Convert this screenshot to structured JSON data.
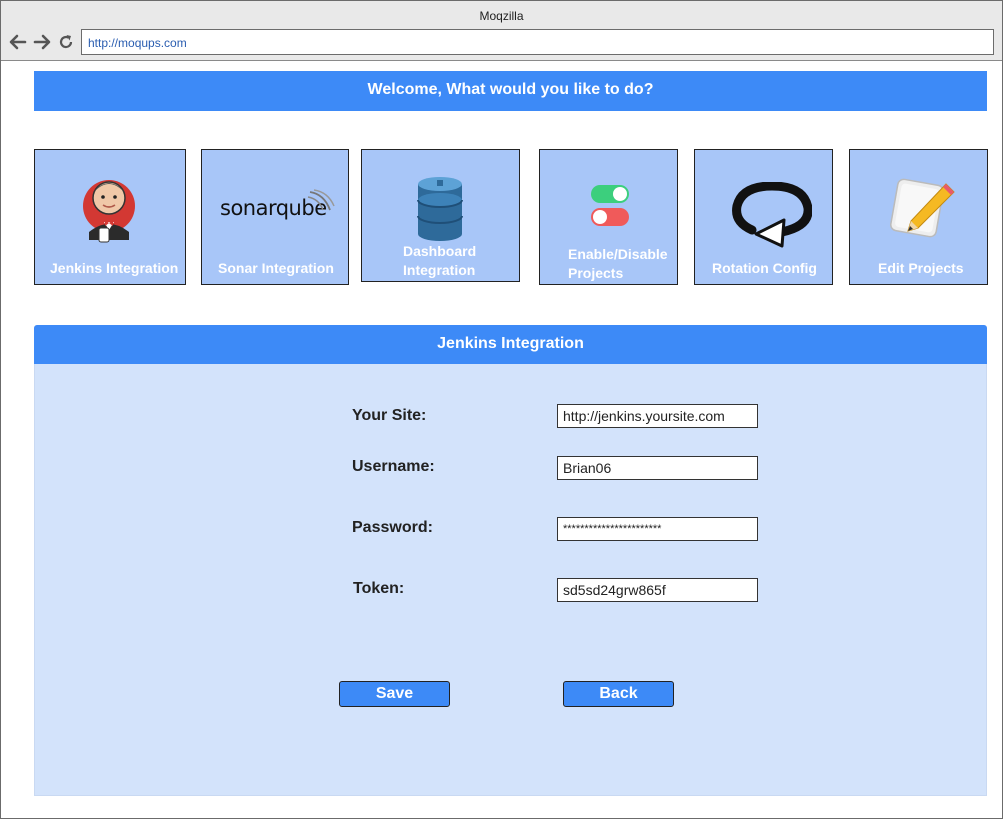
{
  "browser": {
    "title": "Moqzilla",
    "url": "http://moqups.com"
  },
  "welcome": "Welcome, What would you like to do?",
  "tiles": [
    {
      "label": "Jenkins Integration",
      "icon": "jenkins-butler-icon"
    },
    {
      "label": "Sonar Integration",
      "icon": "sonarqube-logo",
      "logo_text": "sonarqube"
    },
    {
      "label_lines": [
        "Dashboard",
        "Integration"
      ],
      "icon": "database-icon"
    },
    {
      "label_lines": [
        "Enable/Disable",
        "Projects"
      ],
      "icon": "toggle-switches-icon"
    },
    {
      "label": "Rotation Config",
      "icon": "rotation-arrow-icon"
    },
    {
      "label": "Edit Projects",
      "icon": "pencil-notepad-icon"
    }
  ],
  "panel": {
    "title": "Jenkins Integration",
    "fields": [
      {
        "label": "Your Site:",
        "value": "http://jenkins.yoursite.com"
      },
      {
        "label": "Username:",
        "value": "Brian06"
      },
      {
        "label": "Password:",
        "value": "***********************"
      },
      {
        "label": "Token:",
        "value": "sd5sd24grw865f"
      }
    ],
    "save_label": "Save",
    "back_label": "Back"
  },
  "colors": {
    "accent": "#3d8af7",
    "tile_bg": "#a8c6f8",
    "panel_bg": "#d3e3fb"
  }
}
